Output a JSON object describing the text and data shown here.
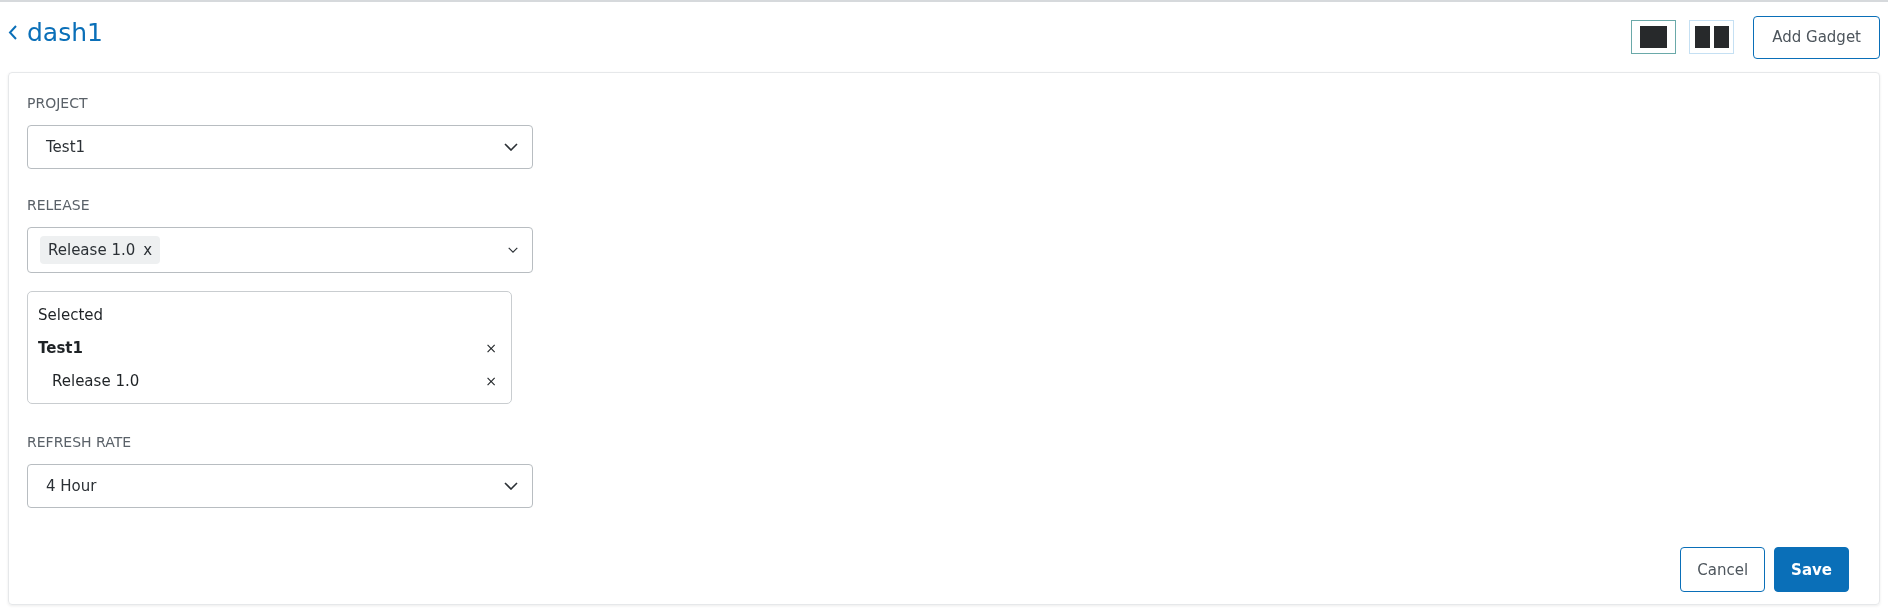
{
  "header": {
    "back_label": "dash1",
    "layouts": [
      {
        "kind": "single",
        "selected": true
      },
      {
        "kind": "double",
        "selected": false
      }
    ],
    "add_button": "Add Gadget"
  },
  "form": {
    "fields": [
      {
        "kind": "select",
        "label": "PROJECT",
        "value": "Test1"
      },
      {
        "kind": "multiselect",
        "label": "RELEASE",
        "tags": [
          "Release 1.0"
        ],
        "remove_mark": "x"
      },
      {
        "kind": "summary",
        "title": "Selected",
        "items": [
          {
            "label": "Test1",
            "remove": "×",
            "children": [
              {
                "label": "Release 1.0",
                "remove": "×"
              }
            ]
          }
        ]
      },
      {
        "kind": "select",
        "label": "REFRESH RATE",
        "value": "4 Hour"
      }
    ],
    "buttons": [
      {
        "kind": "secondary",
        "label": "Cancel"
      },
      {
        "kind": "primary",
        "label": "Save"
      }
    ]
  }
}
